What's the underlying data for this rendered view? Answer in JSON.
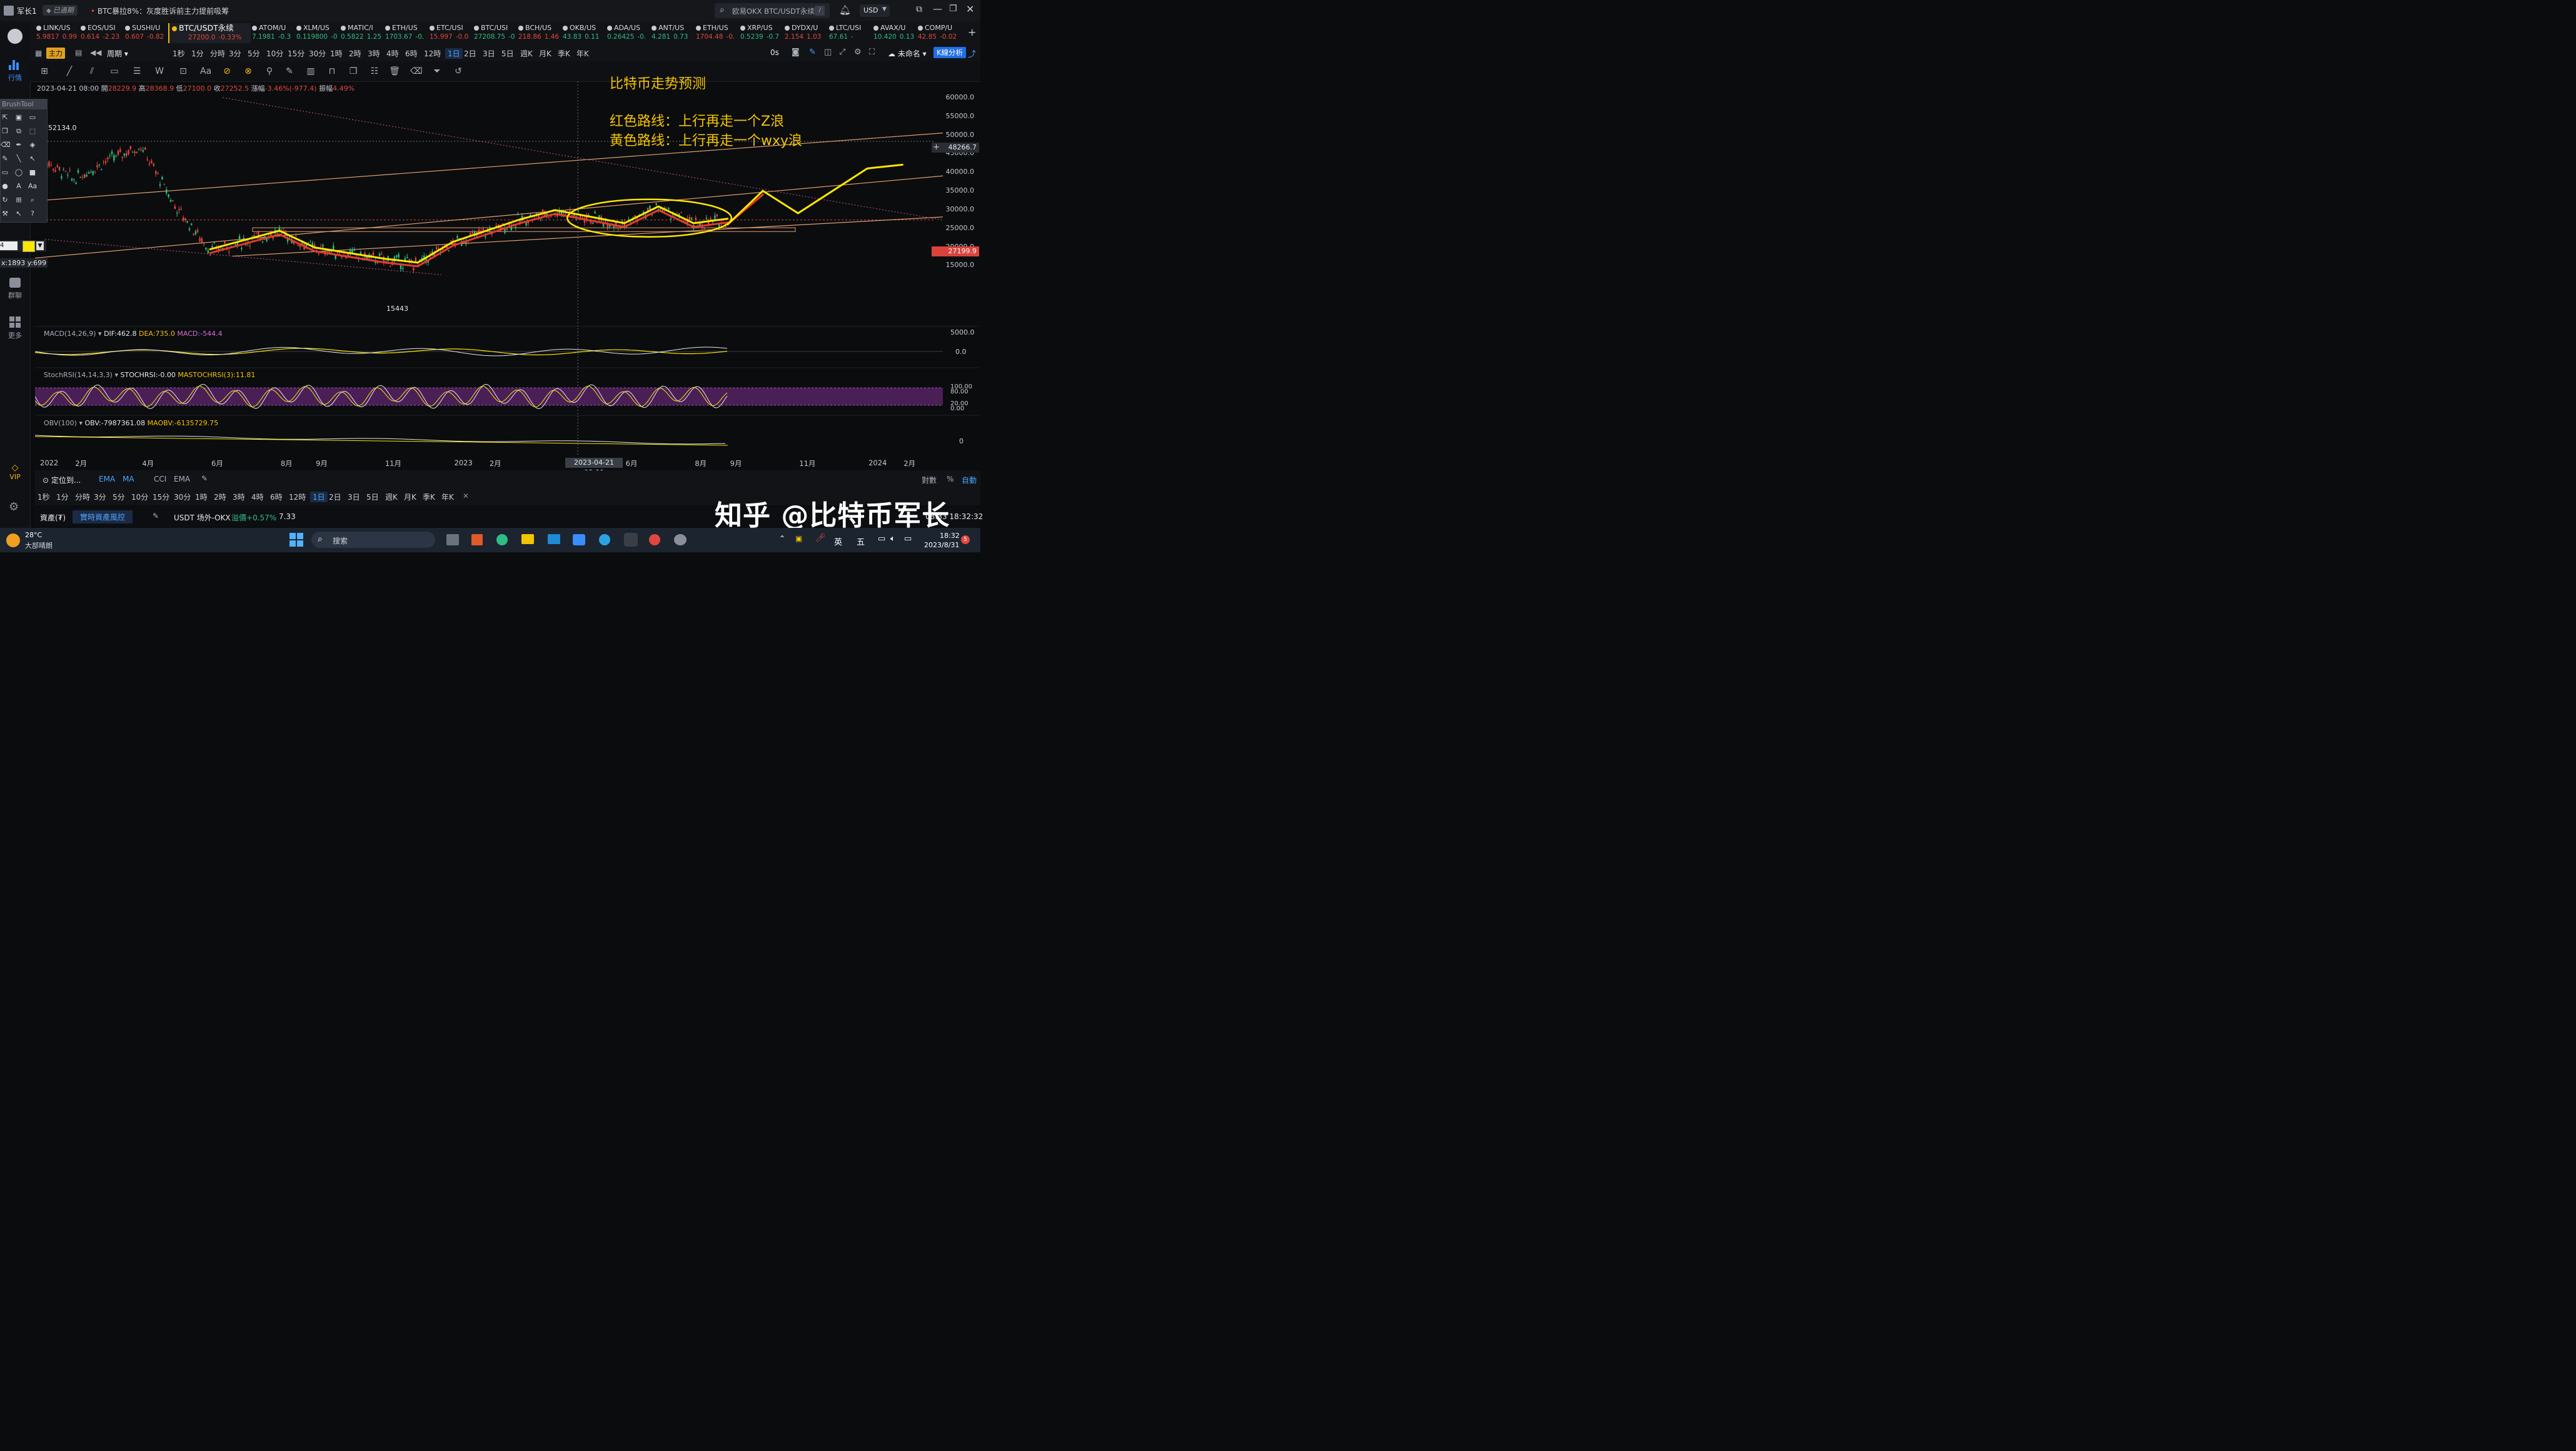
{
  "window": {
    "user_name": "军长1",
    "status_badge": "已過期",
    "news_ticker": "BTC暴拉8%：灰度胜诉前主力提前吸筹",
    "search_placeholder": "欧易OKX BTC/USDT永续",
    "search_shortcut": "/",
    "currency": "USD"
  },
  "sidebar": {
    "items": [
      {
        "label": "行情"
      },
      {
        "label": "群聊"
      },
      {
        "label": "更多"
      },
      {
        "label": "VIP"
      }
    ]
  },
  "tickers": [
    {
      "name": "LINK/US",
      "price": "5.9817",
      "change": "0.99",
      "color": "#e0473e"
    },
    {
      "name": "EOS/USI",
      "price": "0.614",
      "change": "-2.23",
      "color": "#e0473e"
    },
    {
      "name": "SUSHI/U",
      "price": "0.607",
      "change": "-0.82",
      "color": "#e0473e"
    },
    {
      "name": "BTC/USDT永续",
      "price": "27200.0",
      "change": "-0.33%",
      "color": "#e0473e",
      "active": true
    },
    {
      "name": "ATOM/U",
      "price": "7.1981",
      "change": "-0.3",
      "color": "#2ebd85"
    },
    {
      "name": "XLM/US",
      "price": "0.119800",
      "change": "-0",
      "color": "#2ebd85"
    },
    {
      "name": "MATIC/I",
      "price": "0.5822",
      "change": "1.25",
      "color": "#2ebd85"
    },
    {
      "name": "ETH/US",
      "price": "1703.67",
      "change": "-0.",
      "color": "#2ebd85"
    },
    {
      "name": "ETC/USI",
      "price": "15.997",
      "change": "-0.0",
      "color": "#e0473e"
    },
    {
      "name": "BTC/USI",
      "price": "27208.75",
      "change": "-0",
      "color": "#2ebd85"
    },
    {
      "name": "BCH/US",
      "price": "218.86",
      "change": "1.46",
      "color": "#e0473e"
    },
    {
      "name": "OKB/US",
      "price": "43.83",
      "change": "0.11",
      "color": "#2ebd85"
    },
    {
      "name": "ADA/US",
      "price": "0.26425",
      "change": "-0.",
      "color": "#2ebd85"
    },
    {
      "name": "ANT/US",
      "price": "4.281",
      "change": "0.73",
      "color": "#2ebd85"
    },
    {
      "name": "ETH/US",
      "price": "1704.48",
      "change": "-0.",
      "color": "#e0473e"
    },
    {
      "name": "XRP/US",
      "price": "0.5239",
      "change": "-0.7",
      "color": "#2ebd85"
    },
    {
      "name": "DYDX/U",
      "price": "2.154",
      "change": "1.03",
      "color": "#e0473e"
    },
    {
      "name": "LTC/USI",
      "price": "67.61",
      "change": "-",
      "color": "#2ebd85"
    },
    {
      "name": "AVAX/U",
      "price": "10.420",
      "change": "0.13",
      "color": "#2ebd85"
    },
    {
      "name": "COMP/U",
      "price": "42.85",
      "change": "-0.02",
      "color": "#e0473e"
    }
  ],
  "periodbar": {
    "main_label": "主力",
    "period_label": "周期",
    "periods": [
      "1秒",
      "1分",
      "分時",
      "3分",
      "5分",
      "10分",
      "15分",
      "30分",
      "1時",
      "2時",
      "3時",
      "4時",
      "6時",
      "12時",
      "1日",
      "2日",
      "3日",
      "5日",
      "週K",
      "月K",
      "季K",
      "年K"
    ],
    "active": "1日",
    "right_items": [
      "0s",
      "未命名",
      "K線分析"
    ]
  },
  "candle_info": {
    "date": "2023-04-21 08:00",
    "open_label": "開",
    "open": "28229.9",
    "high_label": "高",
    "high": "28368.9",
    "low_label": "低",
    "low": "27100.0",
    "close_label": "收",
    "close": "27252.5",
    "change_label": "漲幅",
    "change": "-3.46%(-977.4)",
    "amp_label": "振幅",
    "amp": "4.49%"
  },
  "annotations": {
    "title": "比特币走势预测",
    "line1": "红色路线：上行再走一个Z浪",
    "line2": "黄色路线：上行再走一个wxy浪",
    "high_label": "52134.0",
    "low_label": "15443"
  },
  "brushtool": {
    "title": "BrushTool",
    "size": "4",
    "coords": "x:1893 y:699"
  },
  "yaxis": {
    "ticks": [
      "60000.0",
      "55000.0",
      "50000.0",
      "45000.0",
      "40000.0",
      "35000.0",
      "30000.0",
      "25000.0",
      "20000.0",
      "15000.0",
      "5000.0",
      "0.0"
    ],
    "crosshair_price": "48266.7",
    "last_price": "27199.9"
  },
  "indicators": {
    "macd": {
      "label": "MACD(14,26,9)",
      "dif": "DIF:462.8",
      "dea": "DEA:735.0",
      "macd": "MACD:-544.4",
      "axis": "0.0"
    },
    "stochrsi": {
      "label": "StochRSI(14,14,3,3)",
      "val": "STOCHRSI:-0.00",
      "ma": "MASTOCHRSI(3):11.81",
      "axis_top": "100.00",
      "axis_80": "80.00",
      "axis_20": "20.00",
      "axis_0": "0.00"
    },
    "obv": {
      "label": "OBV(100)",
      "val": "OBV:-7987361.08",
      "ma": "MAOBV:-6135729.75",
      "axis": "0"
    }
  },
  "xaxis": {
    "labels": [
      "2022",
      "2月",
      "4月",
      "6月",
      "8月",
      "9月",
      "11月",
      "2023",
      "2月",
      "6月",
      "8月",
      "9月",
      "11月",
      "2024",
      "2月"
    ],
    "crosshair_date": "2023-04-21 08:00"
  },
  "bottom": {
    "locate": "定位到...",
    "indicators": [
      "EMA",
      "MA",
      "CCI",
      "EMA"
    ],
    "periods": [
      "1秒",
      "1分",
      "分時",
      "3分",
      "5分",
      "10分",
      "15分",
      "30分",
      "1時",
      "2時",
      "3時",
      "4時",
      "6時",
      "12時",
      "1日",
      "2日",
      "3日",
      "5日",
      "週K",
      "月K",
      "季K",
      "年K"
    ],
    "active": "1日",
    "right": [
      "對數",
      "%",
      "自動"
    ],
    "assets_label": "資產(₮)",
    "risk_label": "實時資產風控",
    "otc_label": "USDT 场外-OKX",
    "premium_label": "溢價",
    "premium_val": "+0.57%",
    "premium_price": "7.33",
    "clock": "08:33 18:32:32"
  },
  "watermark": "知乎 @比特币军长",
  "taskbar": {
    "weather_temp": "28°C",
    "weather_desc": "大部晴朗",
    "search": "搜索",
    "ime1": "英",
    "ime2": "五",
    "time": "18:32",
    "date": "2023/8/31",
    "notif": "5"
  },
  "chart_data": {
    "type": "candlestick-annotated",
    "symbol": "BTC/USDT永续",
    "ylim": [
      0,
      62000
    ],
    "prices_approx": [
      {
        "date": "2022-01",
        "value": 44000
      },
      {
        "date": "2022-02",
        "value": 38000
      },
      {
        "date": "2022-03",
        "value": 43000
      },
      {
        "date": "2022-04",
        "value": 47000
      },
      {
        "date": "2022-05",
        "value": 31000
      },
      {
        "date": "2022-06",
        "value": 19000
      },
      {
        "date": "2022-08",
        "value": 24000
      },
      {
        "date": "2022-09",
        "value": 19500
      },
      {
        "date": "2022-11",
        "value": 16500
      },
      {
        "date": "2022-12",
        "value": 15443
      },
      {
        "date": "2023-01",
        "value": 21000
      },
      {
        "date": "2023-03",
        "value": 27000
      },
      {
        "date": "2023-04",
        "value": 29500
      },
      {
        "date": "2023-06",
        "value": 26000
      },
      {
        "date": "2023-07",
        "value": 30500
      },
      {
        "date": "2023-08",
        "value": 26000
      },
      {
        "date": "2023-08-31",
        "value": 27200
      }
    ],
    "projection_red": [
      {
        "date": "2023-08-31",
        "value": 26000
      },
      {
        "date": "2023-10",
        "value": 34000
      }
    ],
    "projection_yellow": [
      {
        "date": "2023-08-31",
        "value": 26000
      },
      {
        "date": "2023-10",
        "value": 35000
      },
      {
        "date": "2023-11",
        "value": 29000
      },
      {
        "date": "2024-01",
        "value": 41000
      },
      {
        "date": "2024-02",
        "value": 42000
      }
    ],
    "xlabel": "",
    "ylabel": ""
  }
}
